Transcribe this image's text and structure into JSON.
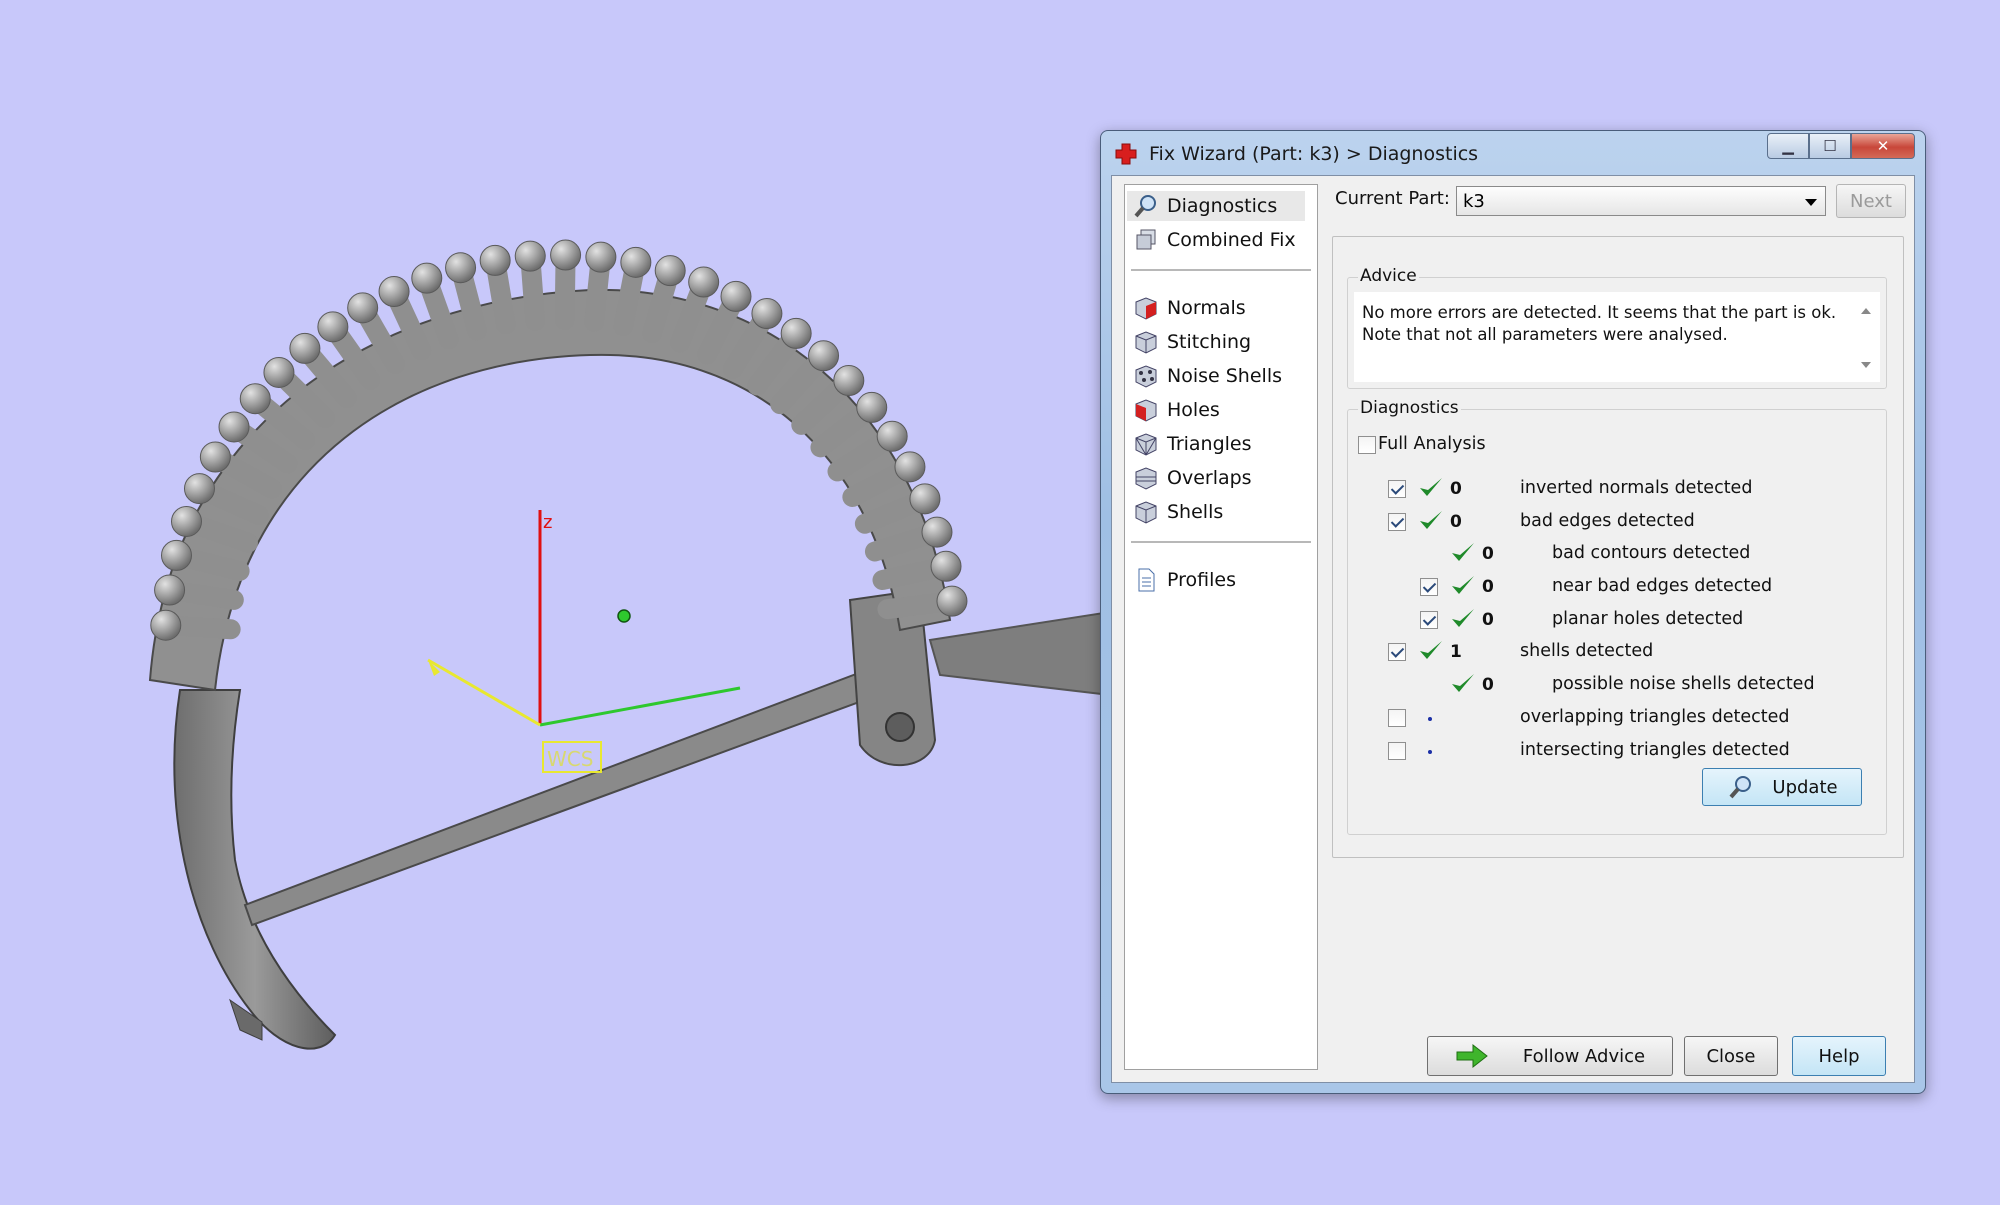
{
  "viewport": {
    "axis_z_label": "z",
    "wcs_label": "WCS",
    "colors": {
      "background": "#c8c8fa",
      "model": "#8e8e8e",
      "axis_x": "#e8e830",
      "axis_y": "#2ec82e",
      "axis_z": "#e01010"
    }
  },
  "dialog": {
    "title": "Fix Wizard (Part: k3) > Diagnostics",
    "sidebar": {
      "items": [
        {
          "label": "Diagnostics",
          "icon": "magnifier-icon",
          "selected": true
        },
        {
          "label": "Combined Fix",
          "icon": "combined-fix-icon"
        },
        {
          "label": "Normals",
          "icon": "normals-cube-icon"
        },
        {
          "label": "Stitching",
          "icon": "stitching-cube-icon"
        },
        {
          "label": "Noise Shells",
          "icon": "noise-shells-icon"
        },
        {
          "label": "Holes",
          "icon": "holes-cube-icon"
        },
        {
          "label": "Triangles",
          "icon": "triangles-cube-icon"
        },
        {
          "label": "Overlaps",
          "icon": "overlaps-cube-icon"
        },
        {
          "label": "Shells",
          "icon": "shells-cube-icon"
        },
        {
          "label": "Profiles",
          "icon": "profiles-document-icon"
        }
      ]
    },
    "current_part_label": "Current Part:",
    "current_part_value": "k3",
    "next_label": "Next",
    "advice": {
      "legend": "Advice",
      "text": "No more errors are detected. It seems that the part is ok. Note that not all parameters were analysed."
    },
    "diagnostics": {
      "legend": "Diagnostics",
      "full_analysis_label": "Full Analysis",
      "full_analysis_checked": false,
      "rows": [
        {
          "checked": true,
          "status": "ok",
          "count": "0",
          "label": "inverted normals detected",
          "indent": 0,
          "has_checkbox": true
        },
        {
          "checked": true,
          "status": "ok",
          "count": "0",
          "label": "bad edges detected",
          "indent": 0,
          "has_checkbox": true
        },
        {
          "checked": false,
          "status": "ok",
          "count": "0",
          "label": "bad contours detected",
          "indent": 1,
          "has_checkbox": false
        },
        {
          "checked": true,
          "status": "ok",
          "count": "0",
          "label": "near bad edges detected",
          "indent": 1,
          "has_checkbox": true
        },
        {
          "checked": true,
          "status": "ok",
          "count": "0",
          "label": "planar holes detected",
          "indent": 1,
          "has_checkbox": true
        },
        {
          "checked": true,
          "status": "ok",
          "count": "1",
          "label": "shells detected",
          "indent": 0,
          "has_checkbox": true
        },
        {
          "checked": false,
          "status": "ok",
          "count": "0",
          "label": "possible noise shells detected",
          "indent": 1,
          "has_checkbox": false
        },
        {
          "checked": false,
          "status": "none",
          "count": "",
          "label": "overlapping triangles detected",
          "indent": 0,
          "has_checkbox": true
        },
        {
          "checked": false,
          "status": "none",
          "count": "",
          "label": "intersecting triangles detected",
          "indent": 0,
          "has_checkbox": true
        }
      ],
      "update_label": "Update"
    },
    "buttons": {
      "follow_advice": "Follow Advice",
      "close": "Close",
      "help": "Help"
    }
  }
}
